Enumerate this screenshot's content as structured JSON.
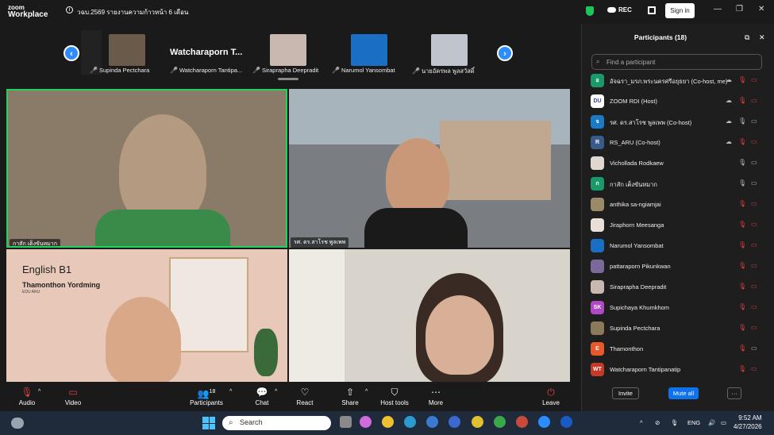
{
  "app": {
    "logo_line1": "zoom",
    "logo_line2": "Workplace",
    "meeting_title": "วฉบ.2569 รายงานความก้าวหน้า 6 เดือน",
    "rec_label": "REC",
    "sign_in_label": "Sign in"
  },
  "window": {
    "minimize": "—",
    "restore": "❐",
    "close": "✕"
  },
  "filmstrip": {
    "prev": "‹",
    "next": "›",
    "featured_title": "Watcharaporn  T...",
    "thumbs": [
      {
        "name": "Supinda Pectchara",
        "color": "#6a5a4a"
      },
      {
        "name": "Watcharaporn Tantipa...",
        "color": "#1a1a1a"
      },
      {
        "name": "Siraprapha Deepradit",
        "color": "#c8b8b0"
      },
      {
        "name": "Narumol Yansombat",
        "color": "#1a6fc4"
      },
      {
        "name": "นายอัครพล พูลสวัสดิ์",
        "color": "#c0c4cc"
      }
    ]
  },
  "tiles": [
    {
      "label": "กาสัก เต็งขันหมาก",
      "color": "#8a7a68"
    },
    {
      "label": "รศ. ดร.สาโรช พูลเพพ",
      "color": "#7a7e82"
    },
    {
      "label": "",
      "color": "#e8c8b8",
      "slide_title": "English B1",
      "slide_name": "Thamonthon Yordming",
      "slide_org": "EDU ARU"
    },
    {
      "label": "",
      "color": "#d8d4cc"
    }
  ],
  "toolbar": {
    "audio": "Audio",
    "video": "Video",
    "participants": "Participants",
    "participants_count": "18",
    "chat": "Chat",
    "react": "React",
    "share": "Share",
    "host_tools": "Host tools",
    "more": "More",
    "leave": "Leave"
  },
  "panel": {
    "title": "Participants (18)",
    "search_placeholder": "Find a participant",
    "invite": "Invite",
    "mute_all": "Mute all",
    "more": "···",
    "participants": [
      {
        "initial": "อ",
        "name": "อัจฉรา_มรภ.พระนครศรีอยุธยา (Co-host, me)",
        "color": "#1a9a6a"
      },
      {
        "initial": "DU",
        "name": "ZOOM RDI (Host)",
        "color": "#ffffff"
      },
      {
        "initial": "จ",
        "name": "รศ. ดร.สาโรช พูลเพพ (Co-host)",
        "color": "#1a7ac4"
      },
      {
        "initial": "R",
        "name": "RS_ARU (Co-host)",
        "color": "#3a5a8a"
      },
      {
        "initial": "",
        "name": "Vichollada Rodkaew",
        "color": "#e0d8d0"
      },
      {
        "initial": "ก",
        "name": "กาสัก เต็งขันหมาก",
        "color": "#1a9a6a"
      },
      {
        "initial": "",
        "name": "anthika sa-ngiamjai",
        "color": "#9a8a6a"
      },
      {
        "initial": "",
        "name": "Jiraphorn Meesanga",
        "color": "#e8e0d8"
      },
      {
        "initial": "",
        "name": "Narumol Yansombat",
        "color": "#1a6fc4"
      },
      {
        "initial": "",
        "name": "pattaraporn Pikunkwan",
        "color": "#7a6a9a"
      },
      {
        "initial": "",
        "name": "Siraprapha Deepradit",
        "color": "#c8b8b0"
      },
      {
        "initial": "SK",
        "name": "Supichaya Khumkhom",
        "color": "#b04ac4"
      },
      {
        "initial": "",
        "name": "Supinda Pectchara",
        "color": "#8a7a5a"
      },
      {
        "initial": "E",
        "name": "Thamonthon",
        "color": "#e8582a"
      },
      {
        "initial": "WT",
        "name": "Watcharaporn Tantipanatip",
        "color": "#c43a2a"
      }
    ]
  },
  "taskbar": {
    "search_placeholder": "Search",
    "lang": "ENG",
    "time": "9:52 AM",
    "date": "4/27/2026"
  }
}
